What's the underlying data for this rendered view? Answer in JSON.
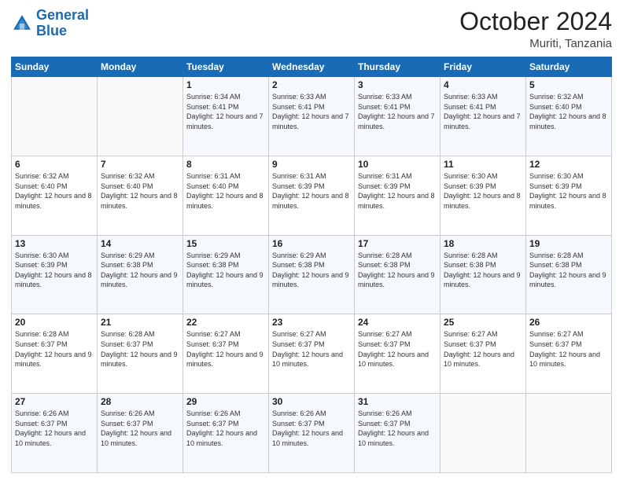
{
  "logo": {
    "line1": "General",
    "line2": "Blue"
  },
  "title": "October 2024",
  "subtitle": "Muriti, Tanzania",
  "days_header": [
    "Sunday",
    "Monday",
    "Tuesday",
    "Wednesday",
    "Thursday",
    "Friday",
    "Saturday"
  ],
  "weeks": [
    [
      {
        "day": "",
        "sunrise": "",
        "sunset": "",
        "daylight": ""
      },
      {
        "day": "",
        "sunrise": "",
        "sunset": "",
        "daylight": ""
      },
      {
        "day": "1",
        "sunrise": "Sunrise: 6:34 AM",
        "sunset": "Sunset: 6:41 PM",
        "daylight": "Daylight: 12 hours and 7 minutes."
      },
      {
        "day": "2",
        "sunrise": "Sunrise: 6:33 AM",
        "sunset": "Sunset: 6:41 PM",
        "daylight": "Daylight: 12 hours and 7 minutes."
      },
      {
        "day": "3",
        "sunrise": "Sunrise: 6:33 AM",
        "sunset": "Sunset: 6:41 PM",
        "daylight": "Daylight: 12 hours and 7 minutes."
      },
      {
        "day": "4",
        "sunrise": "Sunrise: 6:33 AM",
        "sunset": "Sunset: 6:41 PM",
        "daylight": "Daylight: 12 hours and 7 minutes."
      },
      {
        "day": "5",
        "sunrise": "Sunrise: 6:32 AM",
        "sunset": "Sunset: 6:40 PM",
        "daylight": "Daylight: 12 hours and 8 minutes."
      }
    ],
    [
      {
        "day": "6",
        "sunrise": "Sunrise: 6:32 AM",
        "sunset": "Sunset: 6:40 PM",
        "daylight": "Daylight: 12 hours and 8 minutes."
      },
      {
        "day": "7",
        "sunrise": "Sunrise: 6:32 AM",
        "sunset": "Sunset: 6:40 PM",
        "daylight": "Daylight: 12 hours and 8 minutes."
      },
      {
        "day": "8",
        "sunrise": "Sunrise: 6:31 AM",
        "sunset": "Sunset: 6:40 PM",
        "daylight": "Daylight: 12 hours and 8 minutes."
      },
      {
        "day": "9",
        "sunrise": "Sunrise: 6:31 AM",
        "sunset": "Sunset: 6:39 PM",
        "daylight": "Daylight: 12 hours and 8 minutes."
      },
      {
        "day": "10",
        "sunrise": "Sunrise: 6:31 AM",
        "sunset": "Sunset: 6:39 PM",
        "daylight": "Daylight: 12 hours and 8 minutes."
      },
      {
        "day": "11",
        "sunrise": "Sunrise: 6:30 AM",
        "sunset": "Sunset: 6:39 PM",
        "daylight": "Daylight: 12 hours and 8 minutes."
      },
      {
        "day": "12",
        "sunrise": "Sunrise: 6:30 AM",
        "sunset": "Sunset: 6:39 PM",
        "daylight": "Daylight: 12 hours and 8 minutes."
      }
    ],
    [
      {
        "day": "13",
        "sunrise": "Sunrise: 6:30 AM",
        "sunset": "Sunset: 6:39 PM",
        "daylight": "Daylight: 12 hours and 8 minutes."
      },
      {
        "day": "14",
        "sunrise": "Sunrise: 6:29 AM",
        "sunset": "Sunset: 6:38 PM",
        "daylight": "Daylight: 12 hours and 9 minutes."
      },
      {
        "day": "15",
        "sunrise": "Sunrise: 6:29 AM",
        "sunset": "Sunset: 6:38 PM",
        "daylight": "Daylight: 12 hours and 9 minutes."
      },
      {
        "day": "16",
        "sunrise": "Sunrise: 6:29 AM",
        "sunset": "Sunset: 6:38 PM",
        "daylight": "Daylight: 12 hours and 9 minutes."
      },
      {
        "day": "17",
        "sunrise": "Sunrise: 6:28 AM",
        "sunset": "Sunset: 6:38 PM",
        "daylight": "Daylight: 12 hours and 9 minutes."
      },
      {
        "day": "18",
        "sunrise": "Sunrise: 6:28 AM",
        "sunset": "Sunset: 6:38 PM",
        "daylight": "Daylight: 12 hours and 9 minutes."
      },
      {
        "day": "19",
        "sunrise": "Sunrise: 6:28 AM",
        "sunset": "Sunset: 6:38 PM",
        "daylight": "Daylight: 12 hours and 9 minutes."
      }
    ],
    [
      {
        "day": "20",
        "sunrise": "Sunrise: 6:28 AM",
        "sunset": "Sunset: 6:37 PM",
        "daylight": "Daylight: 12 hours and 9 minutes."
      },
      {
        "day": "21",
        "sunrise": "Sunrise: 6:28 AM",
        "sunset": "Sunset: 6:37 PM",
        "daylight": "Daylight: 12 hours and 9 minutes."
      },
      {
        "day": "22",
        "sunrise": "Sunrise: 6:27 AM",
        "sunset": "Sunset: 6:37 PM",
        "daylight": "Daylight: 12 hours and 9 minutes."
      },
      {
        "day": "23",
        "sunrise": "Sunrise: 6:27 AM",
        "sunset": "Sunset: 6:37 PM",
        "daylight": "Daylight: 12 hours and 10 minutes."
      },
      {
        "day": "24",
        "sunrise": "Sunrise: 6:27 AM",
        "sunset": "Sunset: 6:37 PM",
        "daylight": "Daylight: 12 hours and 10 minutes."
      },
      {
        "day": "25",
        "sunrise": "Sunrise: 6:27 AM",
        "sunset": "Sunset: 6:37 PM",
        "daylight": "Daylight: 12 hours and 10 minutes."
      },
      {
        "day": "26",
        "sunrise": "Sunrise: 6:27 AM",
        "sunset": "Sunset: 6:37 PM",
        "daylight": "Daylight: 12 hours and 10 minutes."
      }
    ],
    [
      {
        "day": "27",
        "sunrise": "Sunrise: 6:26 AM",
        "sunset": "Sunset: 6:37 PM",
        "daylight": "Daylight: 12 hours and 10 minutes."
      },
      {
        "day": "28",
        "sunrise": "Sunrise: 6:26 AM",
        "sunset": "Sunset: 6:37 PM",
        "daylight": "Daylight: 12 hours and 10 minutes."
      },
      {
        "day": "29",
        "sunrise": "Sunrise: 6:26 AM",
        "sunset": "Sunset: 6:37 PM",
        "daylight": "Daylight: 12 hours and 10 minutes."
      },
      {
        "day": "30",
        "sunrise": "Sunrise: 6:26 AM",
        "sunset": "Sunset: 6:37 PM",
        "daylight": "Daylight: 12 hours and 10 minutes."
      },
      {
        "day": "31",
        "sunrise": "Sunrise: 6:26 AM",
        "sunset": "Sunset: 6:37 PM",
        "daylight": "Daylight: 12 hours and 10 minutes."
      },
      {
        "day": "",
        "sunrise": "",
        "sunset": "",
        "daylight": ""
      },
      {
        "day": "",
        "sunrise": "",
        "sunset": "",
        "daylight": ""
      }
    ]
  ]
}
